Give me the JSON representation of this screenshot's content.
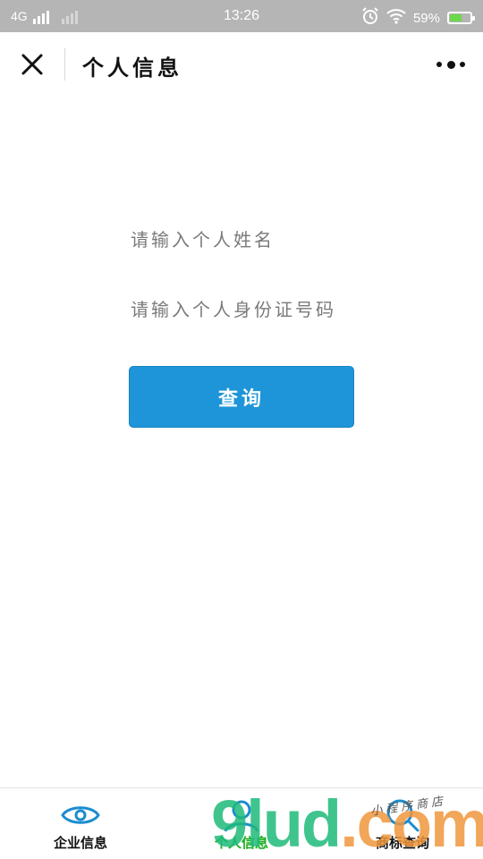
{
  "status_bar": {
    "network": "4G",
    "time": "13:26",
    "battery_percent": "59%",
    "battery_level": 0.59,
    "icons": [
      "alarm-icon",
      "wifi-icon",
      "battery-icon",
      "signal-icon"
    ]
  },
  "navbar": {
    "title": "个人信息",
    "close_icon": "close-icon",
    "more_icon": "more-icon"
  },
  "form": {
    "name_placeholder": "请输入个人姓名",
    "id_placeholder": "请输入个人身份证号码",
    "query_label": "查询"
  },
  "tabbar": {
    "items": [
      {
        "label": "企业信息",
        "icon": "eye-icon",
        "active": false
      },
      {
        "label": "个人信息",
        "icon": "person-icon",
        "active": true
      },
      {
        "label": "商标查询",
        "icon": "search-icon",
        "active": false
      }
    ]
  },
  "watermark": {
    "main": "9lud.com",
    "sub": "小程序商店"
  },
  "colors": {
    "primary": "#1e95d8",
    "active_tab": "#1aad19",
    "status_bar": "#b5b5b5",
    "icon_blue": "#1b8ccf"
  }
}
